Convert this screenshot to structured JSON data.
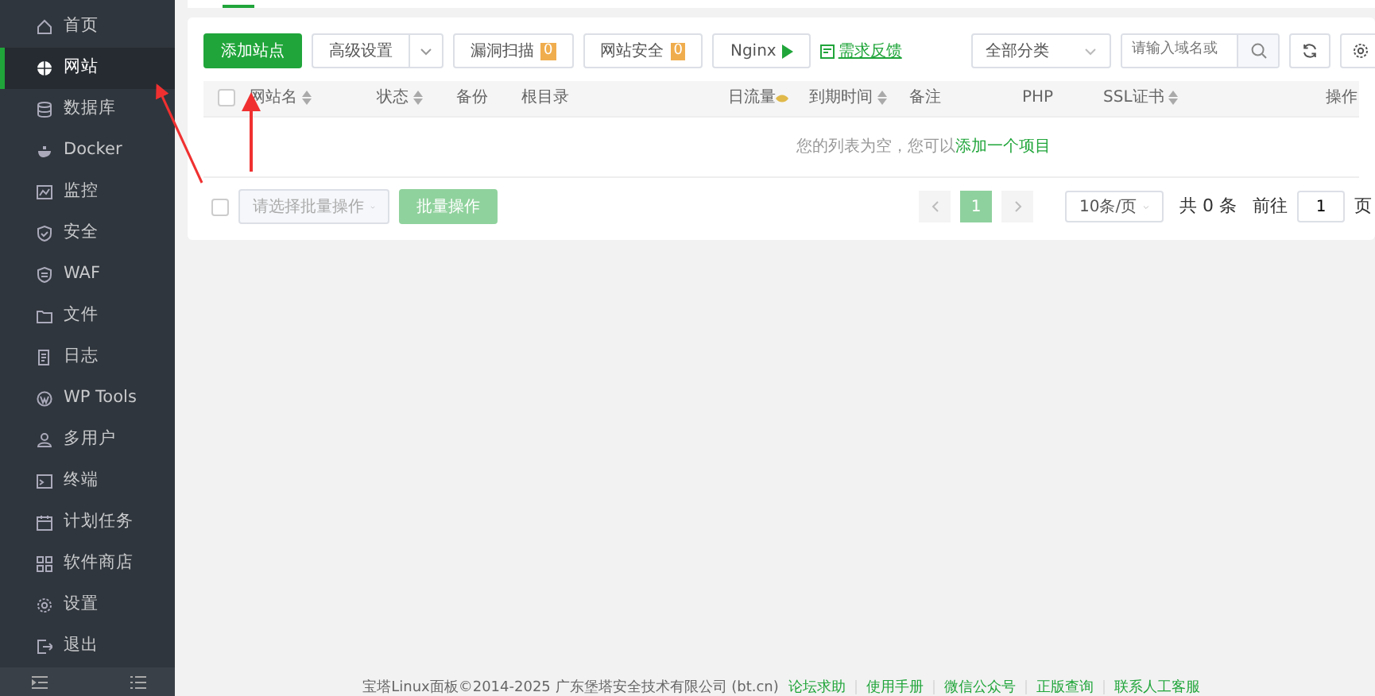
{
  "sidebar": {
    "items": [
      {
        "label": "首页",
        "selected": false
      },
      {
        "label": "网站",
        "selected": true
      },
      {
        "label": "数据库",
        "selected": false
      },
      {
        "label": "Docker",
        "selected": false
      },
      {
        "label": "监控",
        "selected": false
      },
      {
        "label": "安全",
        "selected": false
      },
      {
        "label": "WAF",
        "selected": false
      },
      {
        "label": "文件",
        "selected": false
      },
      {
        "label": "日志",
        "selected": false
      },
      {
        "label": "WP Tools",
        "selected": false
      },
      {
        "label": "多用户",
        "selected": false
      },
      {
        "label": "终端",
        "selected": false
      },
      {
        "label": "计划任务",
        "selected": false
      },
      {
        "label": "软件商店",
        "selected": false
      },
      {
        "label": "设置",
        "selected": false
      },
      {
        "label": "退出",
        "selected": false
      }
    ]
  },
  "toolbar": {
    "buttons": [
      {
        "kind": "primary",
        "label": "添加站点"
      },
      {
        "kind": "split",
        "label": "高级设置"
      },
      {
        "kind": "badge",
        "label": "漏洞扫描",
        "badge": "0"
      },
      {
        "kind": "badge",
        "label": "网站安全",
        "badge": "0"
      },
      {
        "kind": "play",
        "label": "Nginx"
      },
      {
        "kind": "link",
        "label": "需求反馈"
      }
    ],
    "category": "全部分类",
    "search_placeholder": "请输入域名或"
  },
  "table": {
    "select_all_checked": false,
    "columns": [
      {
        "label": "网站名",
        "sortable": true
      },
      {
        "label": "状态",
        "sortable": true
      },
      {
        "label": "备份",
        "sortable": false
      },
      {
        "label": "根目录",
        "sortable": false
      },
      {
        "label": "日流量",
        "sortable": false,
        "hint": true
      },
      {
        "label": "到期时间",
        "sortable": true
      },
      {
        "label": "备注",
        "sortable": false
      },
      {
        "label": "PHP",
        "sortable": false
      },
      {
        "label": "SSL证书",
        "sortable": true
      },
      {
        "label": "操作",
        "sortable": false
      }
    ],
    "empty_text": "您的列表为空，您可以",
    "empty_link": "添加一个项目"
  },
  "batch": {
    "checked": false,
    "placeholder": "请选择批量操作",
    "button": "批量操作",
    "disabled": true
  },
  "pagination": {
    "pages": [
      {
        "label": "1",
        "selected": true
      }
    ],
    "page_size": "10条/页",
    "total": "共 0 条",
    "goto": "前往",
    "goto_value": "1",
    "unit": "页"
  },
  "footer": {
    "copyright": "宝塔Linux面板©2014-2025 广东堡塔安全技术有限公司 (bt.cn)",
    "links": [
      "论坛求助",
      "使用手册",
      "微信公众号",
      "正版查询",
      "联系人工客服"
    ]
  }
}
